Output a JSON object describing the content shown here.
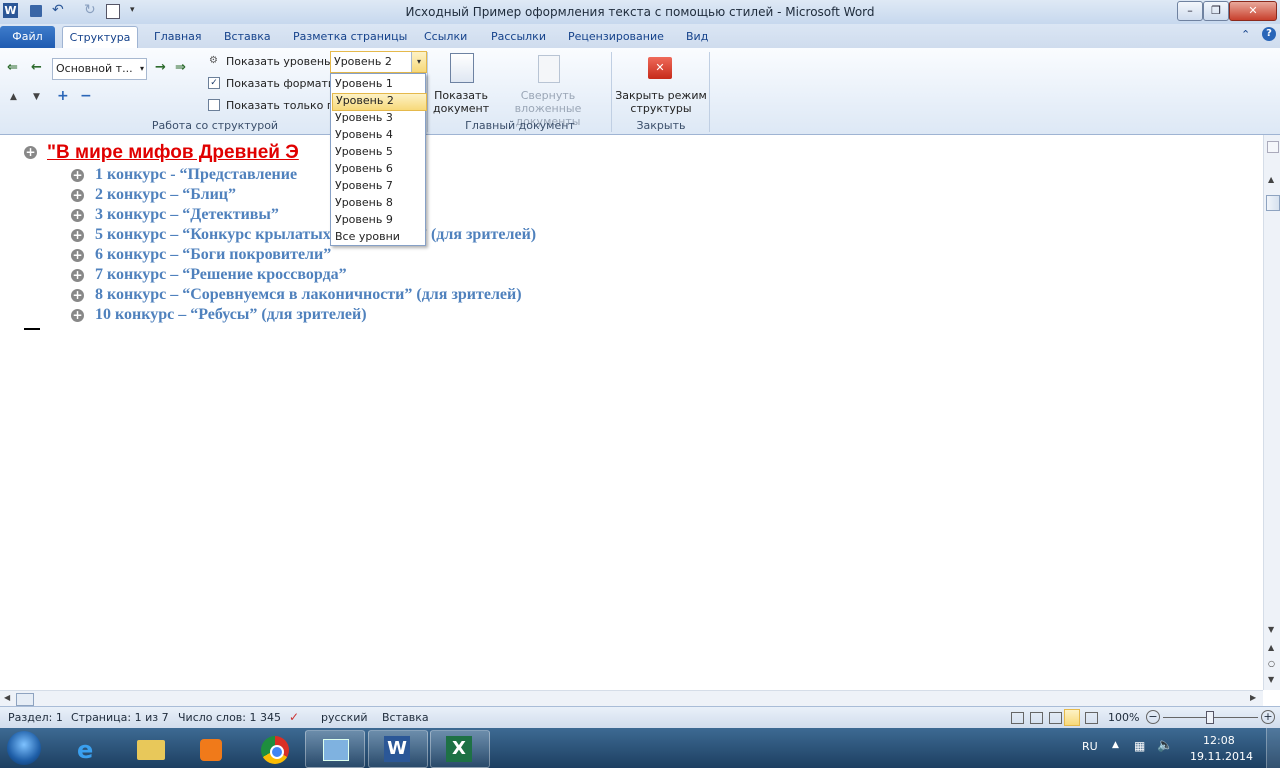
{
  "window": {
    "title": "Исходный Пример оформления текста с помощью стилей  -  Microsoft Word"
  },
  "tabs": {
    "file": "Файл",
    "items": [
      "Структура",
      "Главная",
      "Вставка",
      "Разметка страницы",
      "Ссылки",
      "Рассылки",
      "Рецензирование",
      "Вид"
    ]
  },
  "ribbon": {
    "outline_group": {
      "style_combo_value": "Основной т...",
      "show_level_label": "Показать уровень:",
      "show_level_value": "Уровень 2",
      "show_formatting_label": "Показать форматир",
      "show_first_line_label": "Показать только пе",
      "group_label": "Работа со структурой"
    },
    "master_group": {
      "show_document": "Показать документ",
      "show_document_l1": "Показать",
      "show_document_l2": "документ",
      "collapse_l1": "Свернуть вложенные",
      "collapse_l2": "документы",
      "group_label": "Главный документ"
    },
    "close_group": {
      "close_l1": "Закрыть режим",
      "close_l2": "структуры",
      "group_label": "Закрыть"
    }
  },
  "level_dropdown": {
    "items": [
      "Уровень 1",
      "Уровень 2",
      "Уровень 3",
      "Уровень 4",
      "Уровень 5",
      "Уровень 6",
      "Уровень 7",
      "Уровень 8",
      "Уровень 9",
      "Все уровни"
    ],
    "selected": "Уровень 2"
  },
  "document": {
    "heading1": "\"В мире мифов Древней Э",
    "headings2": [
      "1 конкурс - “Представление",
      "2 конкурс – “Блиц”",
      "3 конкурс – “Детективы”",
      "5 конкурс – “Конкурс крылатых выражений” (для зрителей)",
      "6 конкурс – “Боги покровители”",
      "7 конкурс – “Решение кроссворда”",
      "8 конкурс – “Соревнуемся в лаконичности” (для зрителей)",
      "10 конкурс – “Ребусы” (для зрителей)"
    ]
  },
  "status": {
    "section": "Раздел: 1",
    "page": "Страница: 1 из 7",
    "words": "Число слов: 1 345",
    "language": "русский",
    "mode": "Вставка",
    "zoom": "100%"
  },
  "taskbar": {
    "lang": "RU",
    "time": "12:08",
    "date": "19.11.2014"
  },
  "colors": {
    "heading1": "#e00000",
    "heading2": "#4f81bd",
    "file_tab": "#2a66b8"
  }
}
